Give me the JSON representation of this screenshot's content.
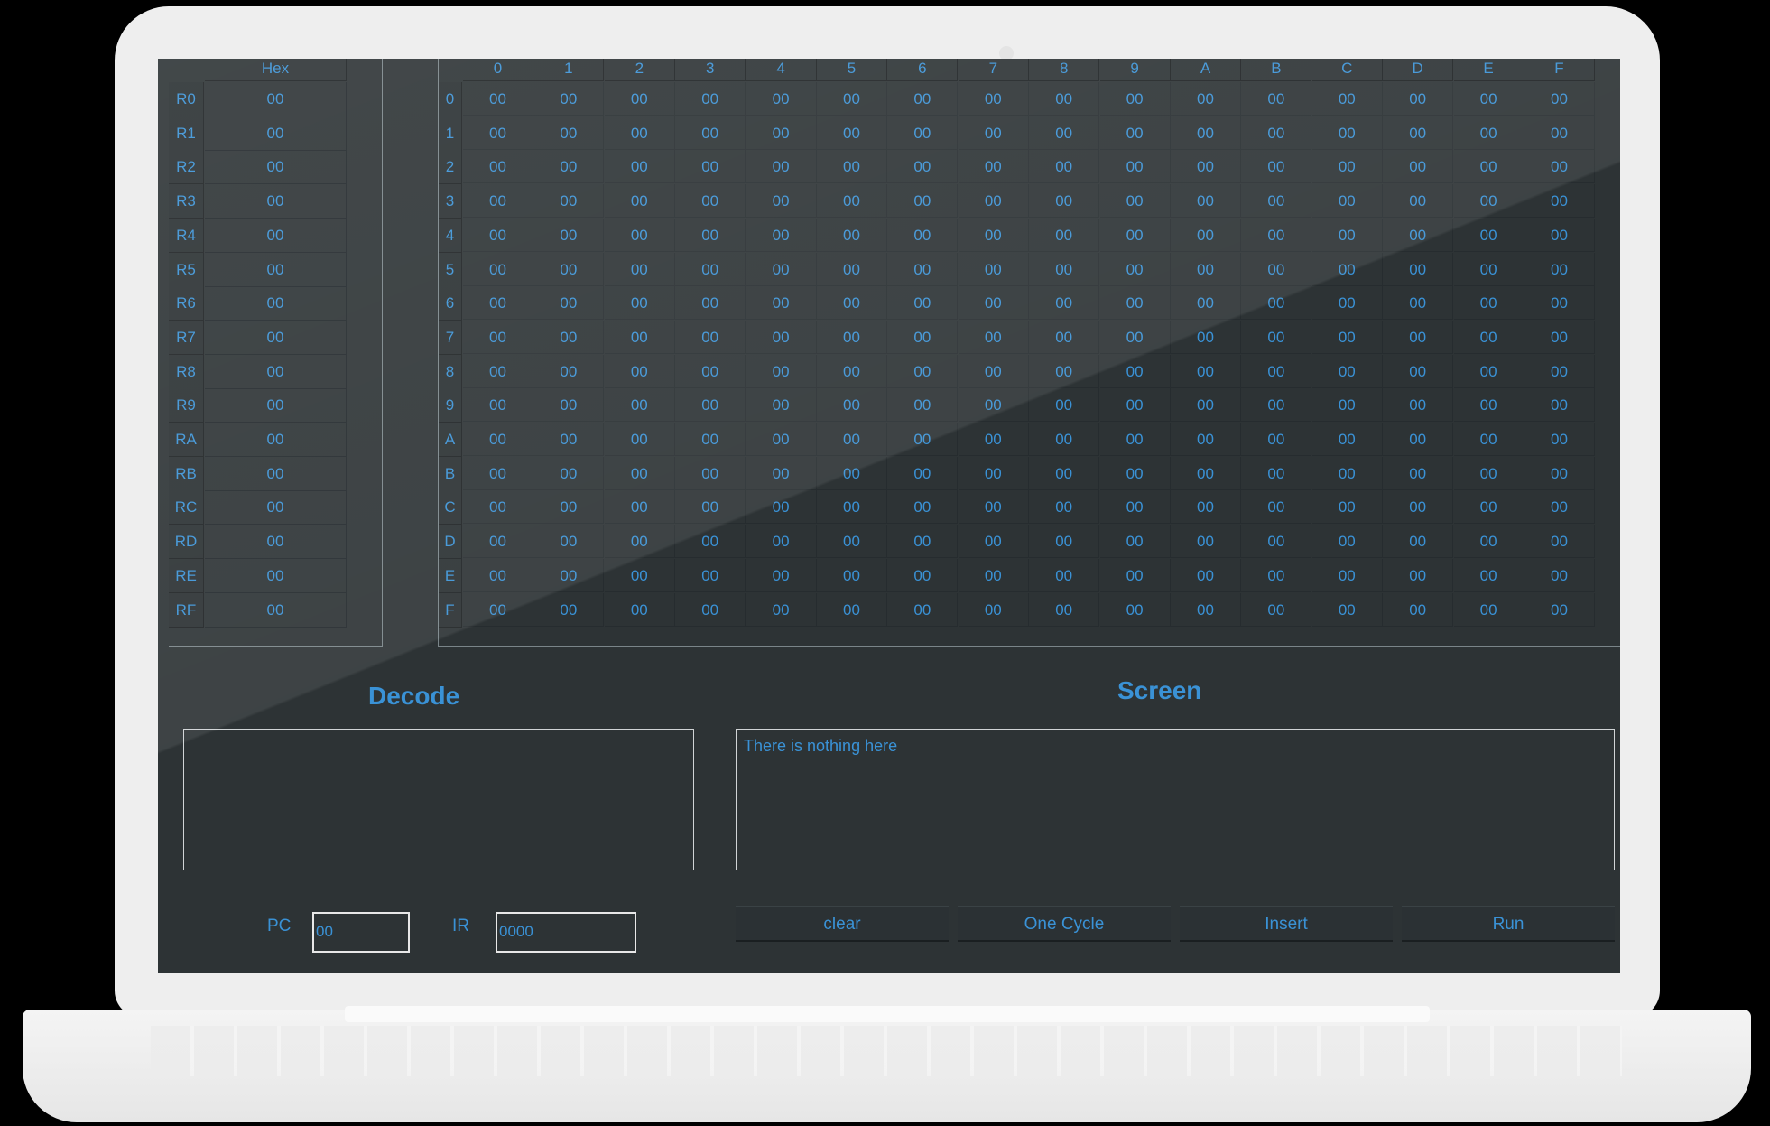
{
  "registers": {
    "header": "Hex",
    "rows": [
      {
        "label": "R0",
        "value": "00"
      },
      {
        "label": "R1",
        "value": "00"
      },
      {
        "label": "R2",
        "value": "00"
      },
      {
        "label": "R3",
        "value": "00"
      },
      {
        "label": "R4",
        "value": "00"
      },
      {
        "label": "R5",
        "value": "00"
      },
      {
        "label": "R6",
        "value": "00"
      },
      {
        "label": "R7",
        "value": "00"
      },
      {
        "label": "R8",
        "value": "00"
      },
      {
        "label": "R9",
        "value": "00"
      },
      {
        "label": "RA",
        "value": "00"
      },
      {
        "label": "RB",
        "value": "00"
      },
      {
        "label": "RC",
        "value": "00"
      },
      {
        "label": "RD",
        "value": "00"
      },
      {
        "label": "RE",
        "value": "00"
      },
      {
        "label": "RF",
        "value": "00"
      }
    ]
  },
  "memory": {
    "columns": [
      "0",
      "1",
      "2",
      "3",
      "4",
      "5",
      "6",
      "7",
      "8",
      "9",
      "A",
      "B",
      "C",
      "D",
      "E",
      "F"
    ],
    "rows": [
      "0",
      "1",
      "2",
      "3",
      "4",
      "5",
      "6",
      "7",
      "8",
      "9",
      "A",
      "B",
      "C",
      "D",
      "E",
      "F"
    ],
    "cells": [
      [
        "00",
        "00",
        "00",
        "00",
        "00",
        "00",
        "00",
        "00",
        "00",
        "00",
        "00",
        "00",
        "00",
        "00",
        "00",
        "00"
      ],
      [
        "00",
        "00",
        "00",
        "00",
        "00",
        "00",
        "00",
        "00",
        "00",
        "00",
        "00",
        "00",
        "00",
        "00",
        "00",
        "00"
      ],
      [
        "00",
        "00",
        "00",
        "00",
        "00",
        "00",
        "00",
        "00",
        "00",
        "00",
        "00",
        "00",
        "00",
        "00",
        "00",
        "00"
      ],
      [
        "00",
        "00",
        "00",
        "00",
        "00",
        "00",
        "00",
        "00",
        "00",
        "00",
        "00",
        "00",
        "00",
        "00",
        "00",
        "00"
      ],
      [
        "00",
        "00",
        "00",
        "00",
        "00",
        "00",
        "00",
        "00",
        "00",
        "00",
        "00",
        "00",
        "00",
        "00",
        "00",
        "00"
      ],
      [
        "00",
        "00",
        "00",
        "00",
        "00",
        "00",
        "00",
        "00",
        "00",
        "00",
        "00",
        "00",
        "00",
        "00",
        "00",
        "00"
      ],
      [
        "00",
        "00",
        "00",
        "00",
        "00",
        "00",
        "00",
        "00",
        "00",
        "00",
        "00",
        "00",
        "00",
        "00",
        "00",
        "00"
      ],
      [
        "00",
        "00",
        "00",
        "00",
        "00",
        "00",
        "00",
        "00",
        "00",
        "00",
        "00",
        "00",
        "00",
        "00",
        "00",
        "00"
      ],
      [
        "00",
        "00",
        "00",
        "00",
        "00",
        "00",
        "00",
        "00",
        "00",
        "00",
        "00",
        "00",
        "00",
        "00",
        "00",
        "00"
      ],
      [
        "00",
        "00",
        "00",
        "00",
        "00",
        "00",
        "00",
        "00",
        "00",
        "00",
        "00",
        "00",
        "00",
        "00",
        "00",
        "00"
      ],
      [
        "00",
        "00",
        "00",
        "00",
        "00",
        "00",
        "00",
        "00",
        "00",
        "00",
        "00",
        "00",
        "00",
        "00",
        "00",
        "00"
      ],
      [
        "00",
        "00",
        "00",
        "00",
        "00",
        "00",
        "00",
        "00",
        "00",
        "00",
        "00",
        "00",
        "00",
        "00",
        "00",
        "00"
      ],
      [
        "00",
        "00",
        "00",
        "00",
        "00",
        "00",
        "00",
        "00",
        "00",
        "00",
        "00",
        "00",
        "00",
        "00",
        "00",
        "00"
      ],
      [
        "00",
        "00",
        "00",
        "00",
        "00",
        "00",
        "00",
        "00",
        "00",
        "00",
        "00",
        "00",
        "00",
        "00",
        "00",
        "00"
      ],
      [
        "00",
        "00",
        "00",
        "00",
        "00",
        "00",
        "00",
        "00",
        "00",
        "00",
        "00",
        "00",
        "00",
        "00",
        "00",
        "00"
      ],
      [
        "00",
        "00",
        "00",
        "00",
        "00",
        "00",
        "00",
        "00",
        "00",
        "00",
        "00",
        "00",
        "00",
        "00",
        "00",
        "00"
      ]
    ]
  },
  "decode": {
    "title": "Decode"
  },
  "screen": {
    "title": "Screen",
    "text": "There is nothing here"
  },
  "pc": {
    "label": "PC",
    "value": "00"
  },
  "ir": {
    "label": "IR",
    "value": "0000"
  },
  "buttons": {
    "clear": "clear",
    "one_cycle": "One Cycle",
    "insert": "Insert",
    "run": "Run"
  },
  "colors": {
    "accent": "#3a92d6",
    "background": "#2d3335"
  }
}
